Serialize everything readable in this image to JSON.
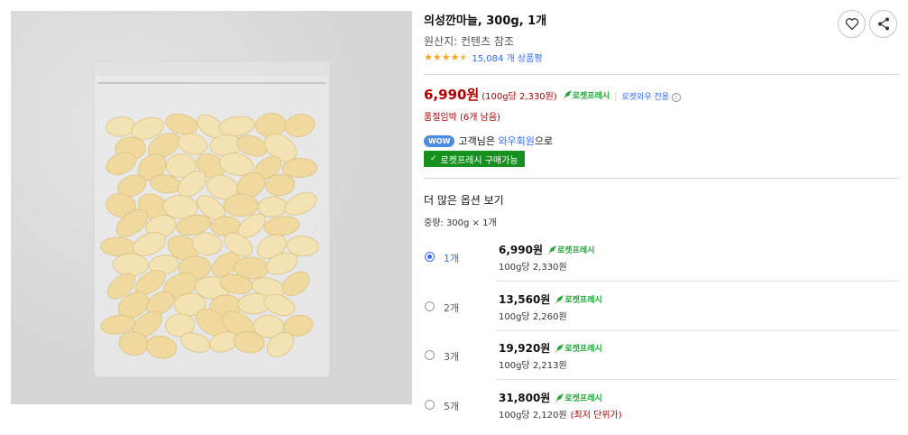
{
  "product": {
    "title": "의성깐마늘, 300g, 1개",
    "origin": "원산지: 컨텐츠 참조",
    "rating_stars": 4.5,
    "review_count": "15,084 개 상품평"
  },
  "price": {
    "main": "6,990원",
    "unit": "(100g당 2,330원)",
    "rocket_label": "로켓프레시",
    "separator": "|",
    "wow_only": "로켓와우 전용",
    "info_icon": "ⓘ"
  },
  "stock": {
    "text": "품절임박 (6개 남음)"
  },
  "wow": {
    "badge": "WOW",
    "prefix": "고객님은",
    "link": "와우회원",
    "suffix": "으로"
  },
  "fresh_button": {
    "check": "✓",
    "label": "로켓프레시 구매가능"
  },
  "options": {
    "header": "더 많은 옵션 보기",
    "sub": "중량: 300g × 1개",
    "items": [
      {
        "qty": "1개",
        "price": "6,990원",
        "rocket": "로켓프레시",
        "unit": "100g당 2,330원",
        "note": "",
        "selected": true
      },
      {
        "qty": "2개",
        "price": "13,560원",
        "rocket": "로켓프레시",
        "unit": "100g당 2,260원",
        "note": "",
        "selected": false
      },
      {
        "qty": "3개",
        "price": "19,920원",
        "rocket": "로켓프레시",
        "unit": "100g당 2,213원",
        "note": "",
        "selected": false
      },
      {
        "qty": "5개",
        "price": "31,800원",
        "rocket": "로켓프레시",
        "unit": "100g당 2,120원",
        "note": "(최저 단위가)",
        "selected": false
      }
    ]
  },
  "icons": {
    "heart": "heart-icon",
    "share": "share-icon",
    "rocket": "rocket-icon"
  },
  "colors": {
    "price_red": "#ae0000",
    "link_blue": "#346aff",
    "rocket_green": "#23a53b",
    "fresh_button": "#16901f",
    "star": "#f5a623"
  }
}
